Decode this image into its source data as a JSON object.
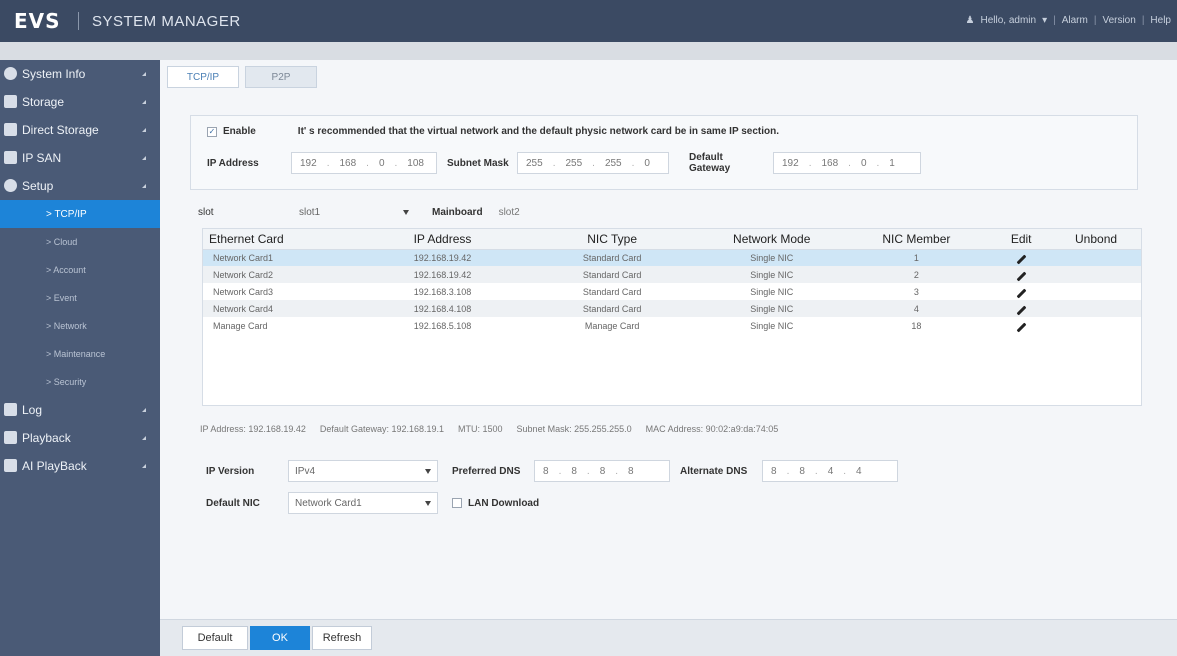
{
  "header": {
    "logo": "EVS",
    "title": "SYSTEM MANAGER",
    "user": "Hello, admin",
    "links": [
      "Alarm",
      "Version",
      "Help"
    ]
  },
  "sidebar": {
    "items": [
      {
        "label": "System Info",
        "icon": "info-icon"
      },
      {
        "label": "Storage",
        "icon": "storage-icon"
      },
      {
        "label": "Direct Storage",
        "icon": "direct-storage-icon"
      },
      {
        "label": "IP SAN",
        "icon": "ip-san-icon"
      },
      {
        "label": "Setup",
        "icon": "gear-icon"
      }
    ],
    "sub_items": [
      "> TCP/IP",
      "> Cloud",
      "> Account",
      "> Event",
      "> Network",
      "> Maintenance",
      "> Security"
    ],
    "bottom_items": [
      {
        "label": "Log",
        "icon": "log-icon"
      },
      {
        "label": "Playback",
        "icon": "playback-icon"
      },
      {
        "label": "AI PlayBack",
        "icon": "ai-playback-icon"
      }
    ]
  },
  "tabs": [
    "TCP/IP",
    "P2P"
  ],
  "virtual": {
    "enable_label": "Enable",
    "notice": "It' s recommended that the virtual network and the default physic network card be in same IP section.",
    "ip_label": "IP Address",
    "ip_value": [
      "192",
      "168",
      "0",
      "108"
    ],
    "mask_label": "Subnet Mask",
    "mask_value": [
      "255",
      "255",
      "255",
      "0"
    ],
    "gateway_label_1": "Default",
    "gateway_label_2": "Gateway",
    "gateway_value": [
      "192",
      "168",
      "0",
      "1"
    ]
  },
  "slot": {
    "label": "slot",
    "value": "slot1",
    "mainboard_label": "Mainboard",
    "mainboard_value": "slot2"
  },
  "table": {
    "headers": [
      "Ethernet Card",
      "IP Address",
      "NIC Type",
      "Network Mode",
      "NIC Member",
      "Edit",
      "Unbond"
    ],
    "rows": [
      [
        "Network Card1",
        "192.168.19.42",
        "Standard Card",
        "Single NIC",
        "1"
      ],
      [
        "Network Card2",
        "192.168.19.42",
        "Standard Card",
        "Single NIC",
        "2"
      ],
      [
        "Network Card3",
        "192.168.3.108",
        "Standard Card",
        "Single NIC",
        "3"
      ],
      [
        "Network Card4",
        "192.168.4.108",
        "Standard Card",
        "Single NIC",
        "4"
      ],
      [
        "Manage Card",
        "192.168.5.108",
        "Manage Card",
        "Single NIC",
        "18"
      ]
    ]
  },
  "info": {
    "ip": "IP Address: 192.168.19.42",
    "gateway": "Default Gateway: 192.168.19.1",
    "mtu": "MTU: 1500",
    "mask": "Subnet Mask: 255.255.255.0",
    "mac": "MAC Address: 90:02:a9:da:74:05"
  },
  "dns": {
    "ipver_label": "IP Version",
    "ipver_value": "IPv4",
    "pref_label": "Preferred DNS",
    "pref_value": [
      "8",
      "8",
      "8",
      "8"
    ],
    "alt_label": "Alternate DNS",
    "alt_value": [
      "8",
      "8",
      "4",
      "4"
    ],
    "nic_label": "Default NIC",
    "nic_value": "Network Card1",
    "lan_label": "LAN Download"
  },
  "buttons": {
    "default": "Default",
    "ok": "OK",
    "refresh": "Refresh"
  }
}
